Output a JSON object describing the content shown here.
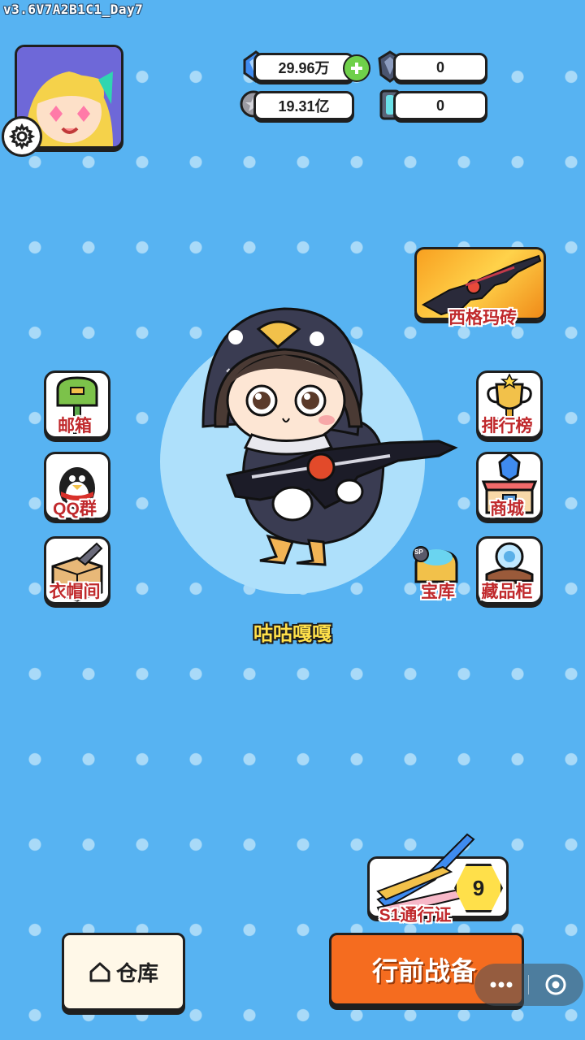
{
  "version": "v3.6V7A2B1C1_Day7",
  "resources": {
    "gems": "29.96万",
    "crystal": "0",
    "coins": "19.31亿",
    "battery": "0"
  },
  "menu": {
    "mailbox": "邮箱",
    "qq_group": "QQ群",
    "wardrobe": "衣帽间",
    "ranking": "排行榜",
    "shop": "商城",
    "treasury": "宝库",
    "collection": "藏品柜",
    "treasury_badge": "SP"
  },
  "featured_weapon": "西格玛砖",
  "character_name": "咕咕嘎嘎",
  "pass": {
    "label": "S1通行证",
    "level": "9"
  },
  "buttons": {
    "warehouse": "仓库",
    "battle_prep": "行前战备"
  },
  "colors": {
    "background": "#57b3f2",
    "label_red": "#c0292c",
    "battle_orange": "#f56c1f",
    "name_yellow": "#ffe04a"
  }
}
